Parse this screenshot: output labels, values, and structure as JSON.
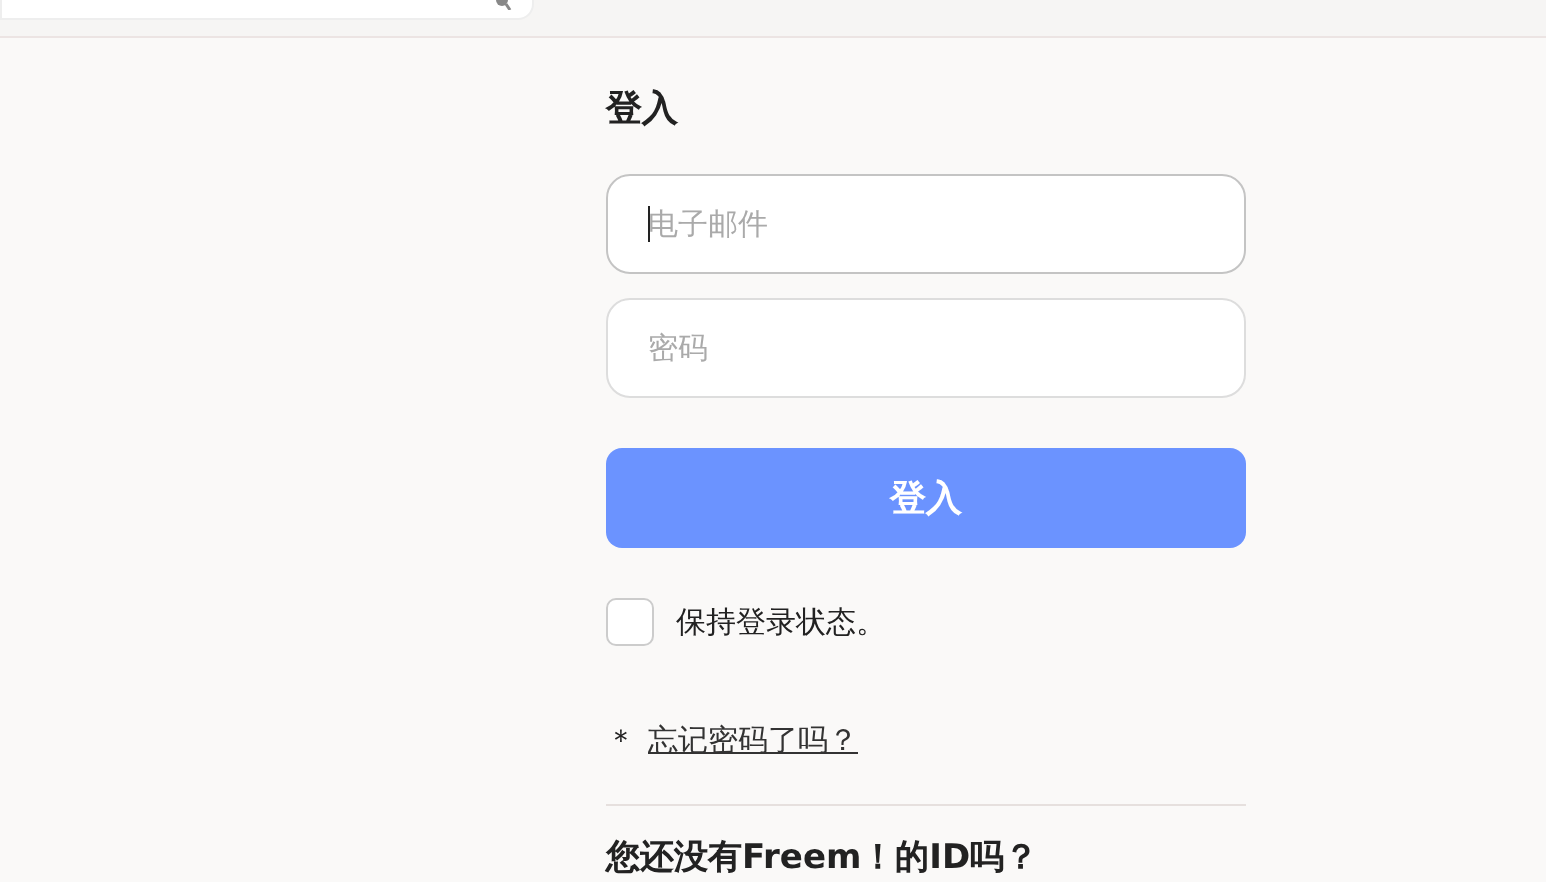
{
  "title": "登入",
  "fields": [
    {
      "placeholder": "电子邮件",
      "focused": true
    },
    {
      "placeholder": "密码",
      "focused": false
    }
  ],
  "submit": "登入",
  "remember": {
    "label": "保持登录状态。",
    "checked": false
  },
  "forgot": {
    "mark": "＊",
    "link": "忘记密码了吗？"
  },
  "signup_heading": "您还没有Freem！的ID吗？"
}
